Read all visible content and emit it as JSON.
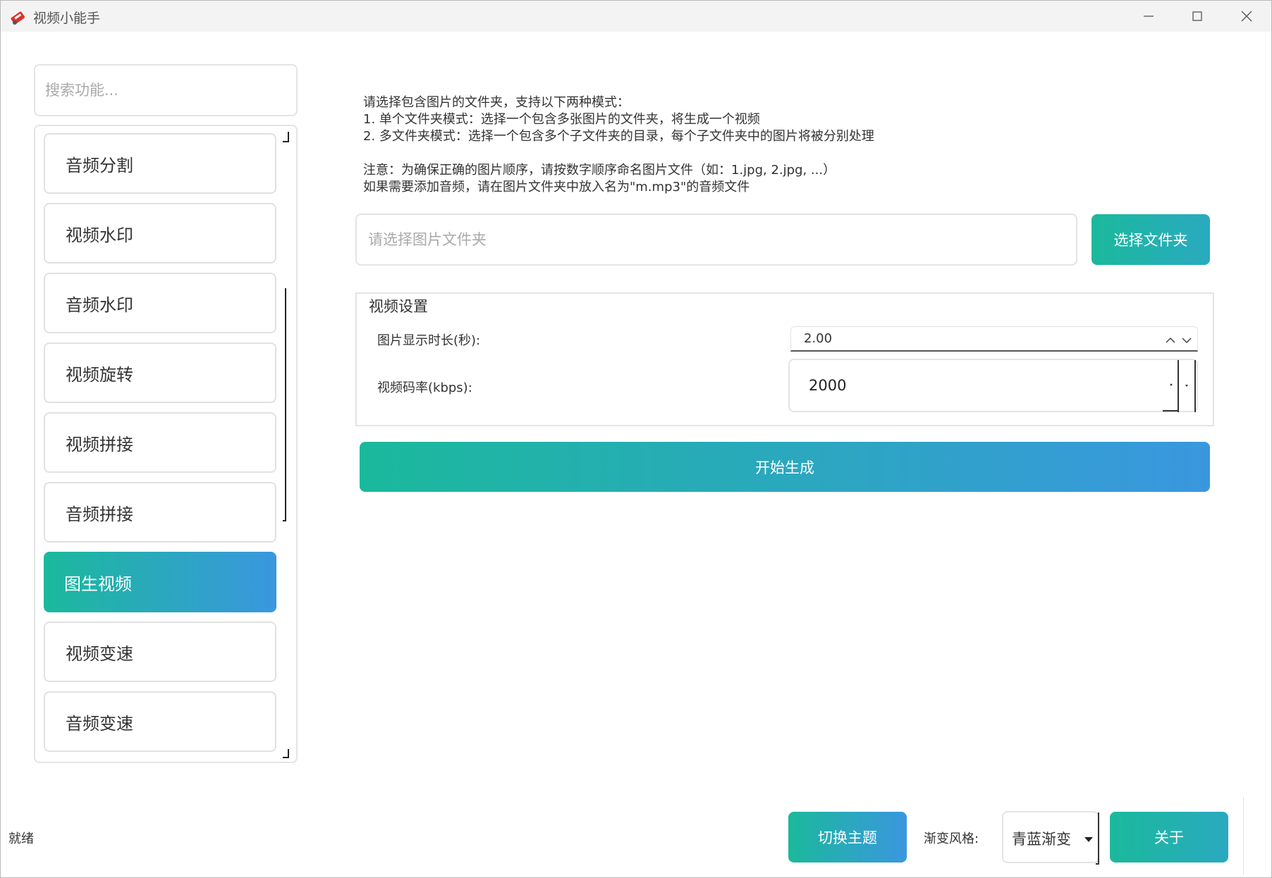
{
  "window": {
    "title": "视频小能手"
  },
  "sidebar": {
    "search_placeholder": "搜索功能...",
    "items": [
      {
        "label": "音频分割"
      },
      {
        "label": "视频水印"
      },
      {
        "label": "音频水印"
      },
      {
        "label": "视频旋转"
      },
      {
        "label": "视频拼接"
      },
      {
        "label": "音频拼接"
      },
      {
        "label": "图生视频",
        "active": true
      },
      {
        "label": "视频变速"
      },
      {
        "label": "音频变速"
      }
    ]
  },
  "main": {
    "instructions": {
      "line1": "请选择包含图片的文件夹，支持以下两种模式：",
      "line2": "1. 单个文件夹模式：选择一个包含多张图片的文件夹，将生成一个视频",
      "line3": "2. 多文件夹模式：选择一个包含多个子文件夹的目录，每个子文件夹中的图片将被分别处理",
      "line4": "注意：为确保正确的图片顺序，请按数字顺序命名图片文件（如：1.jpg, 2.jpg, ...）",
      "line5": "如果需要添加音频，请在图片文件夹中放入名为\"m.mp3\"的音频文件"
    },
    "folder_input": {
      "placeholder": "请选择图片文件夹",
      "value": ""
    },
    "select_folder_label": "选择文件夹",
    "video_settings": {
      "title": "视频设置",
      "duration_label": "图片显示时长(秒):",
      "duration_value": "2.00",
      "bitrate_label": "视频码率(kbps):",
      "bitrate_value": "2000"
    },
    "start_label": "开始生成"
  },
  "statusbar": {
    "status": "就绪",
    "switch_theme_label": "切换主题",
    "gradient_style_label": "渐变风格:",
    "gradient_style_value": "青蓝渐变",
    "about_label": "关于"
  },
  "colors": {
    "accent_start": "#1bb99c",
    "accent_end": "#3a97df",
    "app_icon": "#d9342b"
  }
}
